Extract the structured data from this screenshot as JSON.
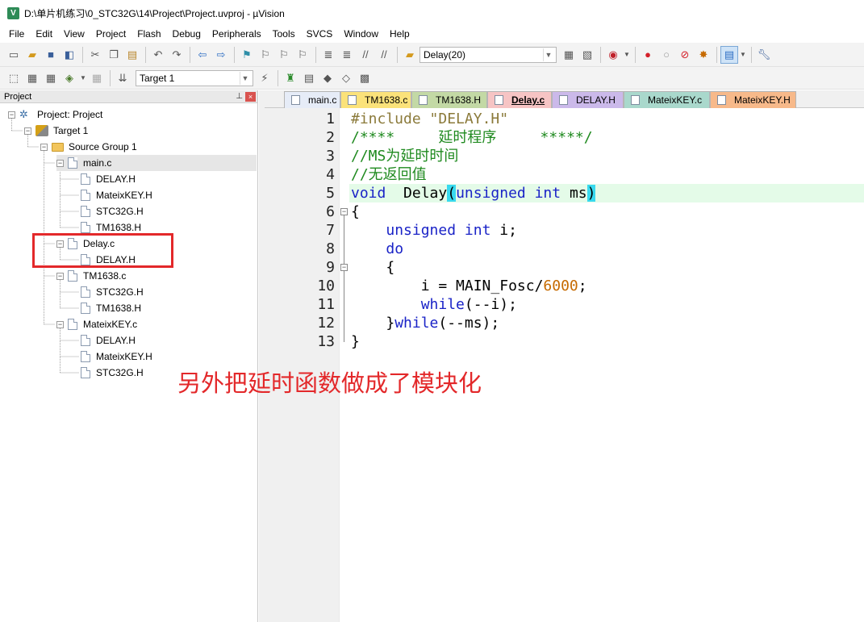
{
  "window": {
    "title": "D:\\单片机练习\\0_STC32G\\14\\Project\\Project.uvproj - µVision",
    "app_icon": "keil-uvision-icon"
  },
  "menu": [
    "File",
    "Edit",
    "View",
    "Project",
    "Flash",
    "Debug",
    "Peripherals",
    "Tools",
    "SVCS",
    "Window",
    "Help"
  ],
  "toolbar": {
    "find_combo_value": "Delay(20)",
    "target_combo_value": "Target 1"
  },
  "project_panel": {
    "title": "Project",
    "pin_glyph": "⊥",
    "close_glyph": "×",
    "tree": {
      "root": "Project: Project",
      "target": "Target 1",
      "group": "Source Group 1",
      "files": [
        {
          "name": "main.c",
          "includes": [
            "DELAY.H",
            "MateixKEY.H",
            "STC32G.H",
            "TM1638.H"
          ]
        },
        {
          "name": "Delay.c",
          "includes": [
            "DELAY.H"
          ]
        },
        {
          "name": "TM1638.c",
          "includes": [
            "STC32G.H",
            "TM1638.H"
          ]
        },
        {
          "name": "MateixKEY.c",
          "includes": [
            "DELAY.H",
            "MateixKEY.H",
            "STC32G.H"
          ]
        }
      ]
    }
  },
  "tabs": [
    {
      "label": "main.c",
      "color": "#e6ecf7"
    },
    {
      "label": "TM1638.c",
      "color": "#fbe27a"
    },
    {
      "label": "TM1638.H",
      "color": "#c3d9a5"
    },
    {
      "label": "Delay.c",
      "color": "#f6c4c4",
      "active": true
    },
    {
      "label": "DELAY.H",
      "color": "#cbb9ea"
    },
    {
      "label": "MateixKEY.c",
      "color": "#a9d8cc"
    },
    {
      "label": "MateixKEY.H",
      "color": "#f7b98a"
    }
  ],
  "editor": {
    "line_numbers": [
      "1",
      "2",
      "3",
      "4",
      "5",
      "6",
      "7",
      "8",
      "9",
      "10",
      "11",
      "12",
      "13"
    ],
    "highlight_color": "#e4fbe8"
  },
  "annotation": {
    "text": "另外把延时函数做成了模块化",
    "color": "#e3282a"
  }
}
